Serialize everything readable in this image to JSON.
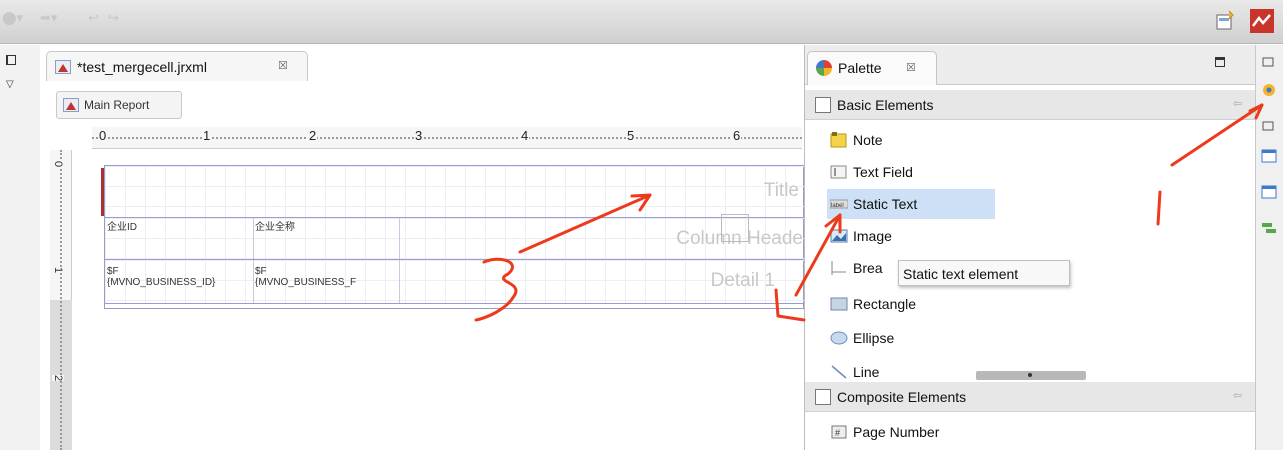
{
  "editor": {
    "tab_label": "*test_mergecell.jrxml",
    "tab_close": "☒",
    "breadcrumb": "Main Report",
    "ruler_numbers": [
      "0",
      "1",
      "2",
      "3",
      "4",
      "5",
      "6"
    ],
    "ruler_v_numbers": [
      "0",
      "1",
      "2"
    ],
    "bands": {
      "title": "Title",
      "column_header": "Column Heade",
      "detail": "Detail 1"
    },
    "cells": {
      "col1_header": "企业ID",
      "col2_header": "企业全称",
      "col1_detail_line1": "$F",
      "col1_detail_line2": "{MVNO_BUSINESS_ID}",
      "col2_detail_line1": "$F",
      "col2_detail_line2": "{MVNO_BUSINESS_F"
    }
  },
  "palette": {
    "title": "Palette",
    "tab_close": "☒",
    "sections": [
      {
        "label": "Basic Elements",
        "arrow": "⇦"
      },
      {
        "label": "Composite Elements",
        "arrow": "⇦"
      }
    ],
    "basic_items": [
      {
        "label": "Note",
        "icon": "note-icon"
      },
      {
        "label": "Text Field",
        "icon": "text-field-icon"
      },
      {
        "label": "Static Text",
        "icon": "label-icon",
        "selected": true
      },
      {
        "label": "Image",
        "icon": "image-icon"
      },
      {
        "label": "Brea",
        "icon": "break-icon"
      },
      {
        "label": "Rectangle",
        "icon": "rectangle-icon"
      },
      {
        "label": "Ellipse",
        "icon": "ellipse-icon"
      },
      {
        "label": "Line",
        "icon": "line-icon"
      }
    ],
    "composite_items": [
      {
        "label": "Page Number",
        "icon": "page-number-icon"
      }
    ],
    "tooltip": "Static text element",
    "static_icon_text": "label"
  },
  "annotations": {
    "numbers": [
      "1",
      "2",
      "3"
    ],
    "color": "#ee3a1c"
  },
  "colors": {
    "selection": "#cde0f5",
    "band_border": "#9a9ad6",
    "title_marker": "#a73030"
  }
}
